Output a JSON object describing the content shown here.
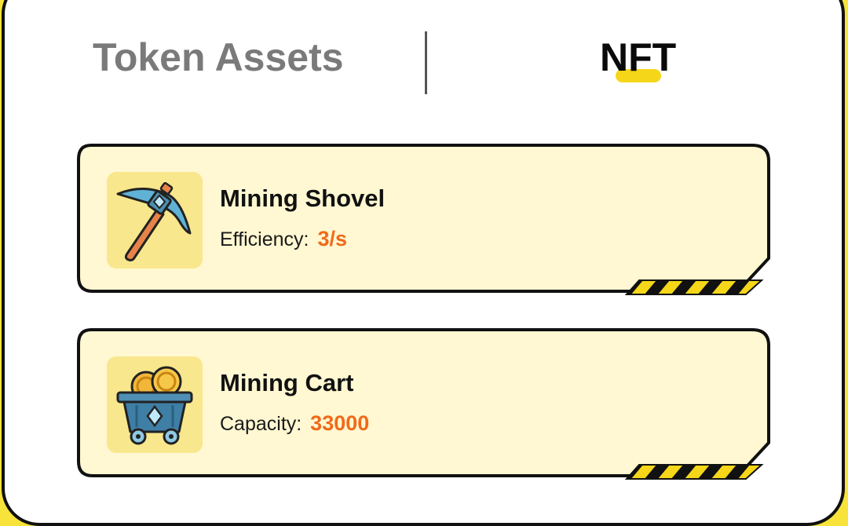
{
  "tabs": {
    "token_assets": "Token Assets",
    "nft": "NFT",
    "active": "NFT"
  },
  "colors": {
    "accent_yellow": "#f5d619",
    "card_bg": "#fff8d2",
    "value_orange": "#f06a1a",
    "inactive_tab": "#7a7a7a"
  },
  "nfts": [
    {
      "name": "Mining Shovel",
      "stat_label": "Efficiency:",
      "stat_value": "3/s",
      "icon": "pickaxe-icon"
    },
    {
      "name": "Mining Cart",
      "stat_label": "Capacity:",
      "stat_value": "33000",
      "icon": "mining-cart-icon"
    }
  ]
}
